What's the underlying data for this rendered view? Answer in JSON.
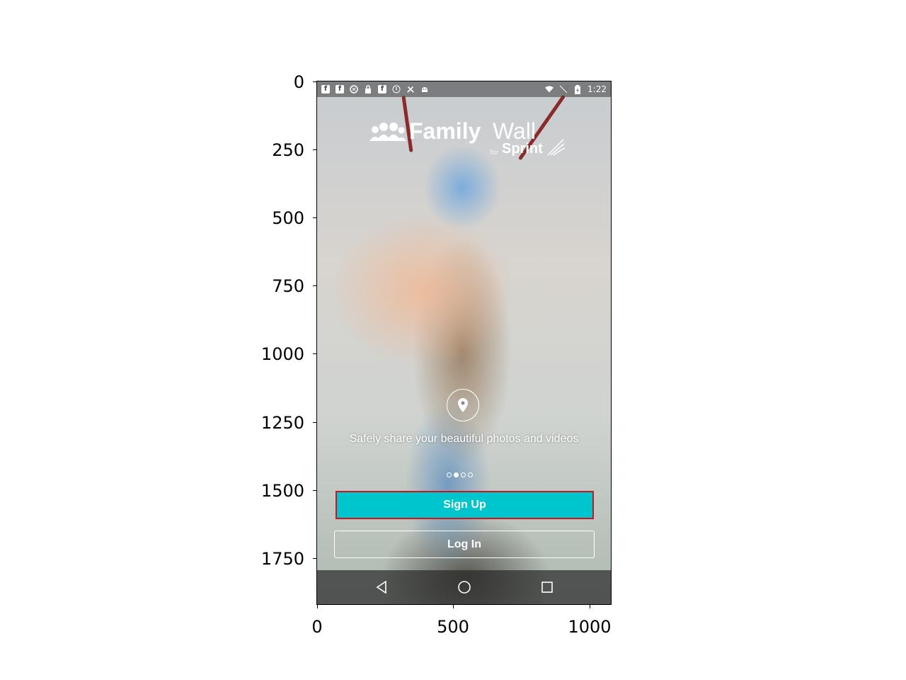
{
  "status_bar": {
    "left_icons": [
      "facebook-icon",
      "facebook-icon",
      "sprint-icon",
      "lock-icon",
      "facebook-icon",
      "info-icon",
      "tools-icon",
      "android-icon"
    ],
    "time": "1:22",
    "right_icons": [
      "wifi-icon",
      "no-signal-icon",
      "battery-icon"
    ]
  },
  "logo": {
    "family": "Family",
    "wall": "Wall",
    "for": "for",
    "sprint": "Sprint"
  },
  "onboarding": {
    "caption": "Safely share your beautiful photos and videos",
    "page_count": 4,
    "active_page": 2
  },
  "buttons": {
    "signup": "Sign Up",
    "login": "Log In"
  },
  "colors": {
    "signup_bg": "#00c5cc",
    "highlight_border": "#d0121b"
  },
  "axes": {
    "y_ticks": [
      "0",
      "250",
      "500",
      "750",
      "1000",
      "1250",
      "1500",
      "1750"
    ],
    "x_ticks": [
      "0",
      "500",
      "1000"
    ]
  }
}
